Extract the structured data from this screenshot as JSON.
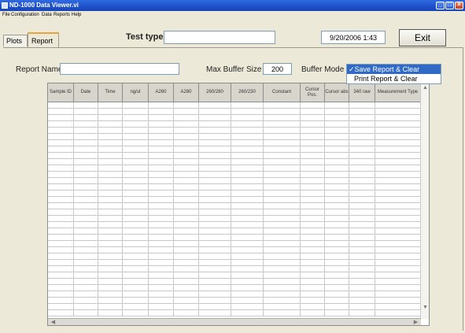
{
  "window": {
    "title": "ND-1000 Data Viewer.vi"
  },
  "menu": [
    "File",
    "Configuration",
    "Data",
    "Reports",
    "Help"
  ],
  "tabs": {
    "plots": "Plots",
    "report": "Report"
  },
  "toolbar": {
    "test_type_label": "Test type:",
    "test_type_value": "",
    "datetime": "9/20/2006 1:43",
    "exit_label": "Exit"
  },
  "report": {
    "name_label": "Report Name",
    "name_value": "",
    "buffer_label": "Max Buffer Size",
    "buffer_value": "200",
    "mode_label": "Buffer Mode",
    "mode_options": [
      "✓Save Report & Clear",
      "Print Report & Clear"
    ]
  },
  "table": {
    "columns": [
      "Sample ID",
      "Date",
      "Time",
      "ng/ul",
      "A260",
      "A280",
      "260/280",
      "260/230",
      "Constant",
      "Cursor Pos.",
      "Cursor abs",
      "340 raw",
      "Measurement Type"
    ]
  },
  "colors": {
    "titlebar": "#1d4fc9",
    "selection": "#316ac5",
    "tab_highlight": "#e8a33c"
  }
}
